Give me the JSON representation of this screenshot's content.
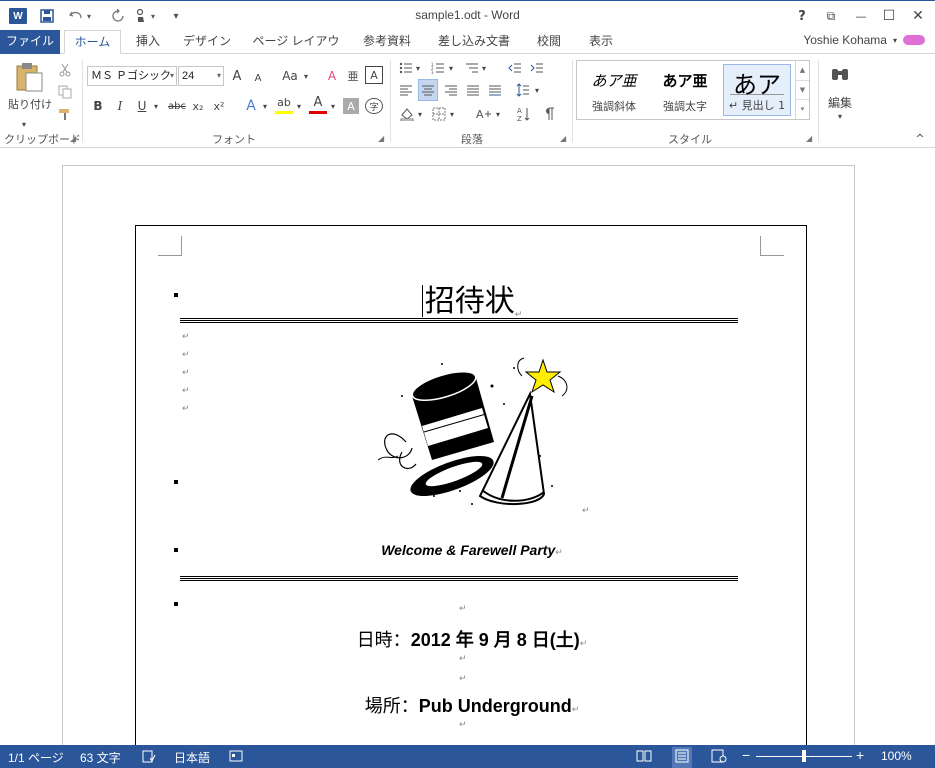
{
  "window": {
    "title": "sample1.odt - Word",
    "app_logo": "W",
    "help_icon": "?",
    "minimize_icon": "—",
    "restore_icon": "☐",
    "close_icon": "✕",
    "ribbon_display_icon": "⧉"
  },
  "quick_access": {
    "save_icon": "save-icon",
    "undo_icon": "undo-icon",
    "redo_icon": "redo-icon",
    "touch_icon": "touch-mode-icon",
    "customize_icon": "▾"
  },
  "tabs": [
    {
      "label": "ファイル"
    },
    {
      "label": "ホーム"
    },
    {
      "label": "挿入"
    },
    {
      "label": "デザイン"
    },
    {
      "label": "ページ レイアウト"
    },
    {
      "label": "参考資料"
    },
    {
      "label": "差し込み文書"
    },
    {
      "label": "校閲"
    },
    {
      "label": "表示"
    }
  ],
  "user": {
    "name": "Yoshie Kohama",
    "dropdown": "▾"
  },
  "ribbon": {
    "clipboard": {
      "paste_label": "貼り付け",
      "group_label": "クリップボード"
    },
    "font": {
      "font_name": "ＭＳ Ｐゴシック",
      "font_size": "24",
      "group_label": "フォント",
      "grow": "A",
      "shrink": "A",
      "change_case": "Aa",
      "bold": "B",
      "italic": "I",
      "underline": "U",
      "strike": "abc",
      "subscript": "x₂",
      "superscript": "x²",
      "text_effects": "A",
      "highlight": "ab",
      "font_color": "A",
      "char_shading": "A",
      "enclose": "字",
      "clear_format": "A",
      "phonetic": "亜"
    },
    "paragraph": {
      "group_label": "段落"
    },
    "styles": {
      "group_label": "スタイル",
      "items": [
        {
          "sample": "あア亜",
          "name": "強調斜体"
        },
        {
          "sample": "あア亜",
          "name": "強調太字"
        },
        {
          "sample": "あア",
          "name": "↵ 見出し 1"
        }
      ]
    },
    "editing": {
      "label": "編集"
    },
    "collapse_icon": "^"
  },
  "document": {
    "title": "招待状",
    "subtitle": "Welcome & Farewell Party",
    "date_prefix": "日時：",
    "date_value": "2012 年 9 月 8 日(土)",
    "place_prefix": "場所：",
    "place_value": "Pub Underground",
    "para_mark": "↵"
  },
  "status": {
    "page": "1/1 ページ",
    "words": "63 文字",
    "language": "日本語",
    "zoom": "100%",
    "zoom_minus": "−",
    "zoom_plus": "+"
  },
  "colors": {
    "accent": "#2b579a",
    "highlight": "#ffff00",
    "font_color": "#e00000"
  }
}
